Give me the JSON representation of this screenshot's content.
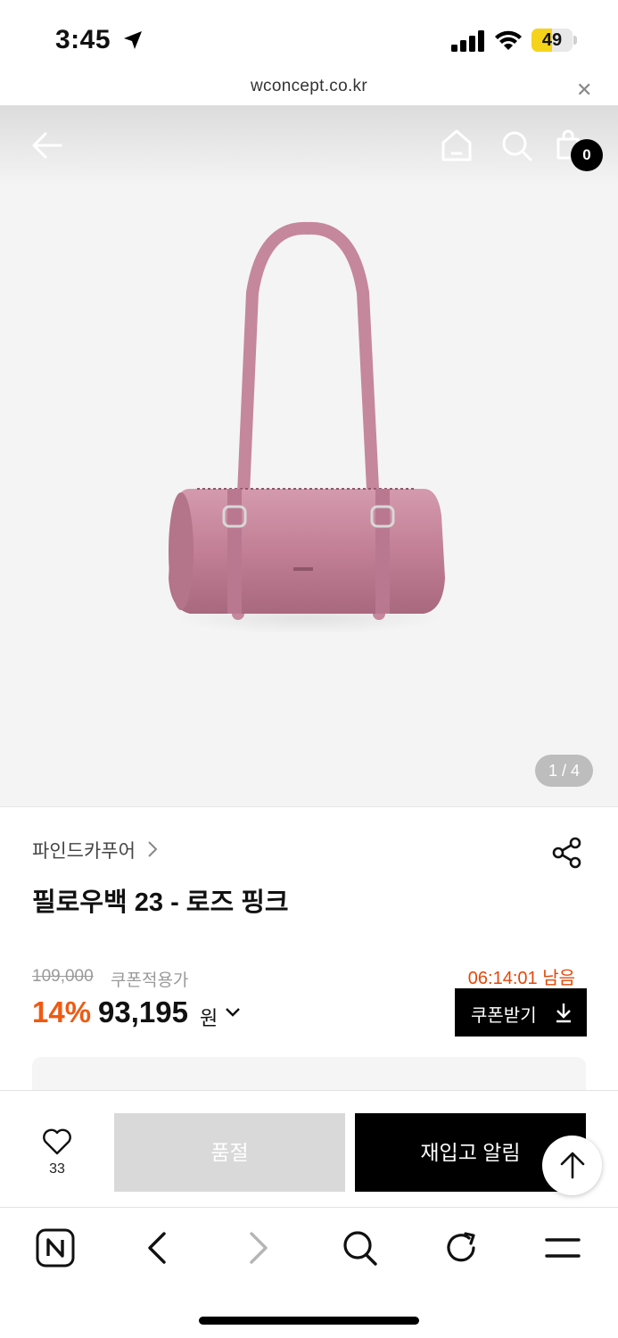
{
  "status_bar": {
    "time": "3:45",
    "battery_level": 49,
    "battery_text": "49",
    "battery_color": "#f5d31a",
    "icons": [
      "location-arrow-icon",
      "cellular-signal-icon",
      "wifi-icon",
      "battery-icon"
    ]
  },
  "browser": {
    "url": "wconcept.co.kr",
    "close_icon": "close-icon"
  },
  "nav": {
    "cart_count": "0",
    "icons": [
      "back-arrow-icon",
      "home-icon",
      "search-icon",
      "shopping-bag-icon"
    ]
  },
  "gallery": {
    "counter": "1 / 4",
    "image_subject": "pink cylindrical shoulder bag",
    "bag_color": "#c98398"
  },
  "product": {
    "brand": "파인드카푸어",
    "name": "필로우백 23 - 로즈 핑크",
    "original_price": "109,000",
    "coupon_applied_label": "쿠폰적용가",
    "timer": "06:14:01 남음",
    "discount": "14%",
    "price": "93,195",
    "currency": "원",
    "coupon_button_label": "쿠폰받기"
  },
  "actions": {
    "like_count": "33",
    "soldout_label": "품절",
    "restock_label": "재입고 알림"
  },
  "colors": {
    "accent_orange": "#ef5a12",
    "timer_orange": "#e3480a",
    "black": "#000000",
    "soldout_gray": "#d9d9d9"
  },
  "toolbar": {
    "icons": [
      "naver-n-icon",
      "back-chevron-icon",
      "forward-chevron-icon",
      "search-icon",
      "reload-icon",
      "menu-icon"
    ]
  }
}
